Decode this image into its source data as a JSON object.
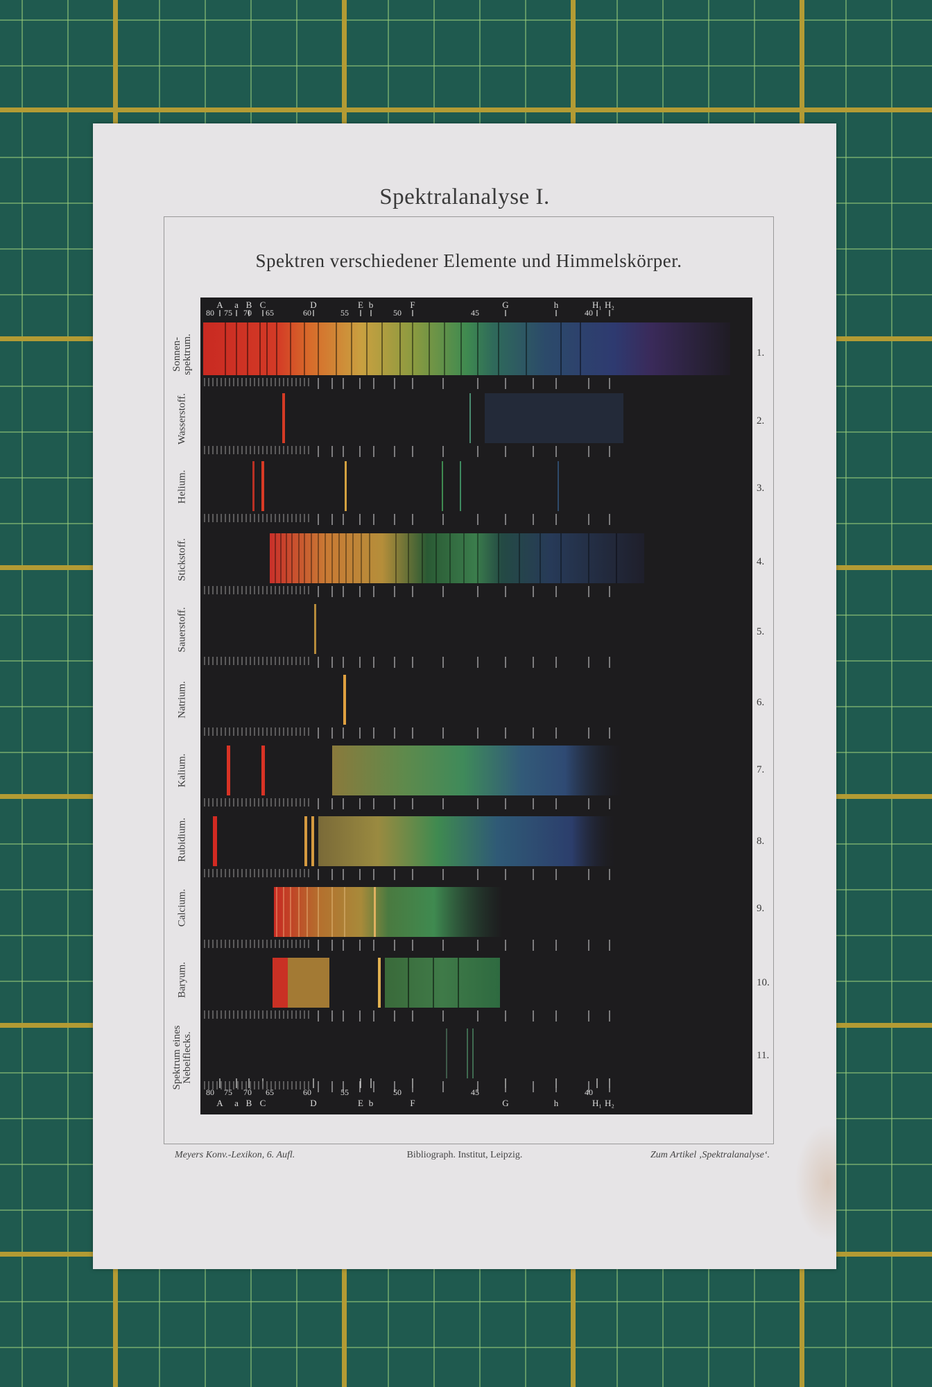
{
  "document": {
    "title": "Spektralanalyse I.",
    "subtitle": "Spektren verschiedener Elemente und Himmelskörper.",
    "footer": {
      "left": "Meyers Konv.-Lexikon, 6. Aufl.",
      "center": "Bibliograph. Institut, Leipzig.",
      "right": "Zum Artikel ‚Spektralanalyse‘."
    }
  },
  "scale": {
    "numbers": [
      "80",
      "75",
      "70",
      "65",
      "60",
      "55",
      "50",
      "45",
      "40"
    ],
    "letters": [
      "A",
      "a",
      "B",
      "C",
      "D",
      "E",
      "b",
      "F",
      "G",
      "h",
      "H₁",
      "H₂"
    ]
  },
  "spectra": [
    {
      "number": "1.",
      "label": "Sonnen-\nspektrum."
    },
    {
      "number": "2.",
      "label": "Wasserstoff."
    },
    {
      "number": "3.",
      "label": "Helium."
    },
    {
      "number": "4.",
      "label": "Stickstoff."
    },
    {
      "number": "5.",
      "label": "Sauerstoff."
    },
    {
      "number": "6.",
      "label": "Natrium."
    },
    {
      "number": "7.",
      "label": "Kalium."
    },
    {
      "number": "8.",
      "label": "Rubidium."
    },
    {
      "number": "9.",
      "label": "Calcium."
    },
    {
      "number": "10.",
      "label": "Baryum."
    },
    {
      "number": "11.",
      "label": "Spektrum eines\nNebelflecks."
    }
  ],
  "colors": {
    "paper": "#e6e4e6",
    "plate": "#1d1c1e",
    "mat": "#1f5a4f",
    "grid": "#b39b34"
  }
}
